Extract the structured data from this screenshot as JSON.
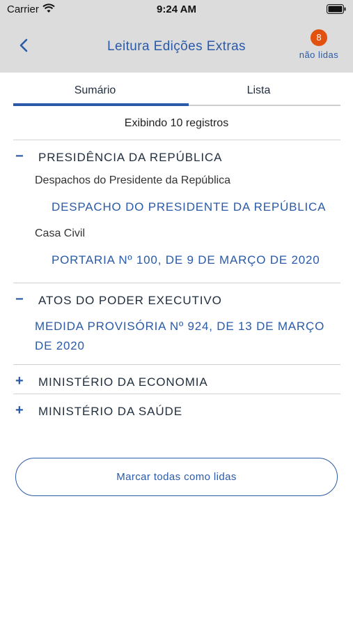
{
  "status_bar": {
    "carrier": "Carrier",
    "time": "9:24 AM"
  },
  "nav": {
    "title": "Leitura Edições Extras",
    "unread_count": "8",
    "unread_label": "não lidas"
  },
  "tabs": [
    {
      "label": "Sumário",
      "active": true
    },
    {
      "label": "Lista",
      "active": false
    }
  ],
  "records_text": "Exibindo 10 registros",
  "sections": [
    {
      "title": "PRESIDÊNCIA DA REPÚBLICA",
      "expanded": true,
      "groups": [
        {
          "subtitle": "Despachos do Presidente da República",
          "items": [
            "DESPACHO DO PRESIDENTE DA REPÚBLICA"
          ]
        },
        {
          "subtitle": "Casa Civil",
          "items": [
            "PORTARIA Nº 100, DE 9 DE MARÇO DE 2020"
          ]
        }
      ]
    },
    {
      "title": "ATOS DO PODER EXECUTIVO",
      "expanded": true,
      "items": [
        "MEDIDA PROVISÓRIA Nº 924, DE 13 DE MARÇO DE 2020"
      ]
    },
    {
      "title": "MINISTÉRIO DA ECONOMIA",
      "expanded": false
    },
    {
      "title": "MINISTÉRIO DA SAÚDE",
      "expanded": false
    }
  ],
  "actions": {
    "mark_all_read": "Marcar todas como lidas"
  },
  "colors": {
    "accent": "#2a5aa8",
    "badge": "#e2520e",
    "header_bg": "#dcdcdc"
  },
  "icons": {
    "back": "chevron-left-icon",
    "expanded": "minus-icon",
    "collapsed": "plus-icon",
    "wifi": "wifi-icon",
    "battery": "battery-icon"
  }
}
